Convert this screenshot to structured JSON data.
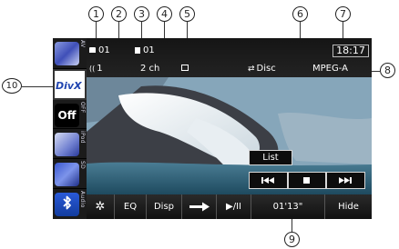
{
  "status": {
    "folder_number": "01",
    "file_number": "01",
    "audio_stream": "1",
    "audio_channels": "2 ch",
    "repeat_mode": "Disc",
    "clock": "18:17",
    "audio_format": "MPEG-A"
  },
  "sources": [
    {
      "label": "AV",
      "icon": "av-source-icon"
    },
    {
      "label": "DivX",
      "icon": "divx-logo"
    },
    {
      "label": "OFF",
      "glyph": "Off",
      "icon": "off-icon"
    },
    {
      "label": "iPod",
      "icon": "ipod-icon"
    },
    {
      "label": "SD",
      "icon": "sd-card-icon"
    },
    {
      "label": "Audio",
      "icon": "bluetooth-audio-icon"
    }
  ],
  "controls": {
    "list_label": "List",
    "prev_icon": "skip-back-icon",
    "stop_icon": "stop-icon",
    "next_icon": "skip-forward-icon"
  },
  "bottom_bar": {
    "settings_icon": "gear-icon",
    "eq_label": "EQ",
    "disp_label": "Disp",
    "arrow_icon": "right-arrow-icon",
    "play_pause_label": "▶/II",
    "play_time": "01'13\"",
    "hide_label": "Hide"
  },
  "callouts": [
    "1",
    "2",
    "3",
    "4",
    "5",
    "6",
    "7",
    "8",
    "9",
    "10"
  ],
  "colors": {
    "screen_background": "#000000",
    "divx_blue": "#2145b0",
    "video_water": "#25536a"
  }
}
